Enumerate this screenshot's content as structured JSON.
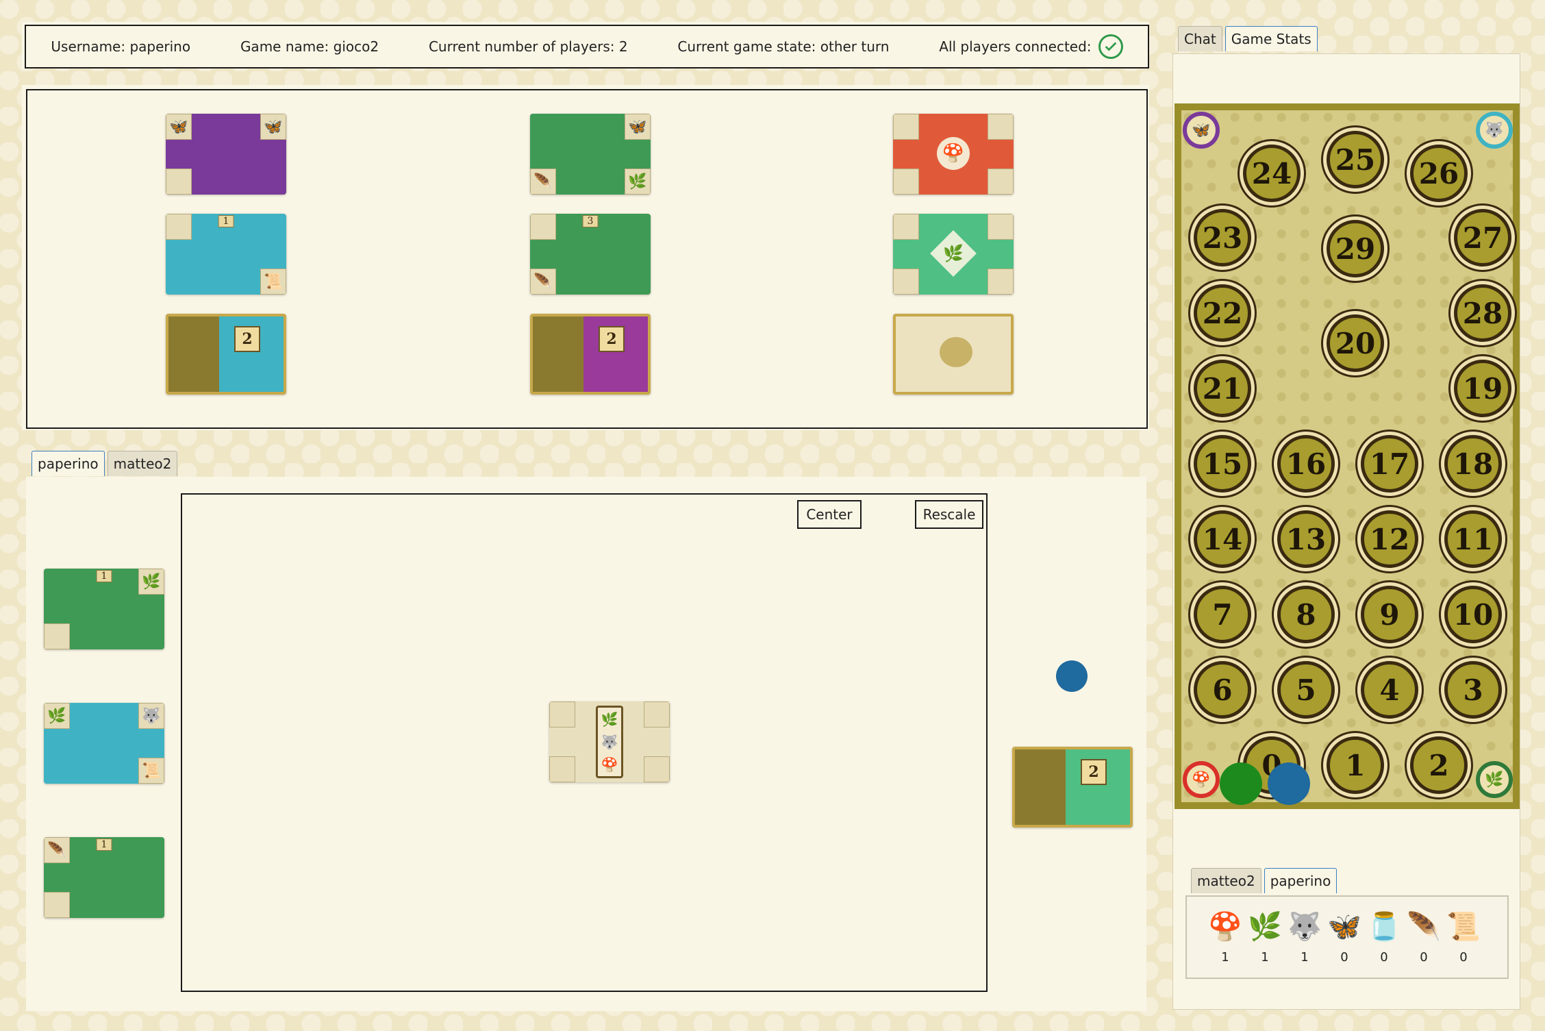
{
  "info": {
    "username": "Username: paperino",
    "game_name": "Game name: gioco2",
    "players": "Current number of players: 2",
    "state": "Current game state: other turn",
    "connected": "All players connected:"
  },
  "market": {
    "rows": [
      [
        "Fungi-like purple insect card",
        "Green plant card",
        "Red mushroom card"
      ],
      [
        "Blue animal card",
        "Green plant card",
        "Green leaf starter card"
      ],
      [
        "Gold objective card",
        "Gold objective card",
        "Gold objective card back"
      ]
    ],
    "row_points": [
      "",
      "1",
      "3",
      "2",
      "2"
    ]
  },
  "player_tabs": [
    "paperino",
    "matteo2"
  ],
  "hand_points": [
    "1",
    "",
    "1"
  ],
  "buttons": {
    "center": "Center",
    "rescale": "Rescale"
  },
  "secret_objective_points": "2",
  "side_tabs": [
    "Chat",
    "Game Stats"
  ],
  "board_spots": [
    "24",
    "25",
    "26",
    "23",
    "29",
    "27",
    "22",
    "28",
    "20",
    "21",
    "19",
    "15",
    "16",
    "17",
    "18",
    "14",
    "13",
    "12",
    "11",
    "7",
    "8",
    "9",
    "10",
    "6",
    "5",
    "4",
    "3",
    "0",
    "1",
    "2"
  ],
  "stats_tabs": [
    "matteo2",
    "paperino"
  ],
  "resources": [
    {
      "icon": "mushroom-icon",
      "glyph": "🍄",
      "value": "1"
    },
    {
      "icon": "leaf-icon",
      "glyph": "🌿",
      "value": "1"
    },
    {
      "icon": "wolf-icon",
      "glyph": "🐺",
      "value": "1"
    },
    {
      "icon": "butterfly-icon",
      "glyph": "🦋",
      "value": "0"
    },
    {
      "icon": "inkwell-icon",
      "glyph": "🫙",
      "value": "0"
    },
    {
      "icon": "quill-icon",
      "glyph": "🪶",
      "value": "0"
    },
    {
      "icon": "scroll-icon",
      "glyph": "📜",
      "value": "0"
    }
  ],
  "colors": {
    "purple": "#7a3a9a",
    "green": "#3f9a55",
    "red": "#e05a3a",
    "blue": "#3fb3c3",
    "gold": "#c8a84a",
    "check": "#2e9a4a"
  }
}
